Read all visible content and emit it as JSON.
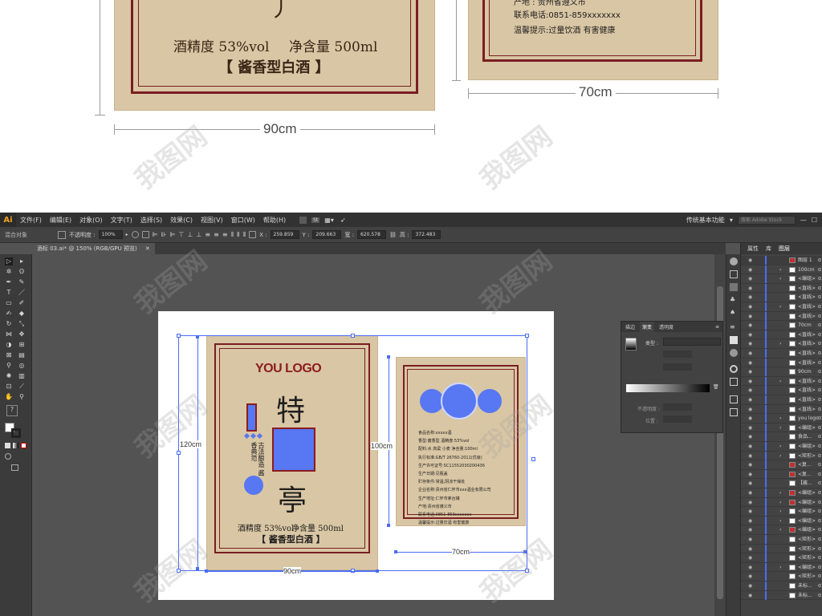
{
  "preview": {
    "big_label": {
      "alcohol": "酒精度 53%vol",
      "volume": "净含量 500ml",
      "type": "【 酱香型白酒 】"
    },
    "small_label": {
      "line_origin": "产地 : 贵州省遵义市",
      "line_phone": "联系电话:0851-859xxxxxxx",
      "line_tip": "温馨提示:过量饮酒 有害健康"
    },
    "dimensions": {
      "big_width": "90cm",
      "small_width": "70cm"
    },
    "watermark": "我图网"
  },
  "app": {
    "logo": "Ai",
    "menu": [
      "文件(F)",
      "编辑(E)",
      "对象(O)",
      "文字(T)",
      "选择(S)",
      "效果(C)",
      "视图(V)",
      "窗口(W)",
      "帮助(H)"
    ],
    "workspace": "传统基本功能",
    "search_placeholder": "搜索 Adobe Stock",
    "mode_icon": "St"
  },
  "control_bar": {
    "selection_label": "混合对象",
    "opacity_label": "不透明度 :",
    "opacity_value": "100%",
    "x_label": "X :",
    "x_value": "259.859",
    "y_label": "Y :",
    "y_value": "209.663",
    "w_label": "宽 :",
    "w_value": "620.578",
    "h_label": "高 :",
    "h_value": "372.483"
  },
  "document": {
    "tab_title": "酒标 03.ai* @ 150% (RGB/GPU 预览)"
  },
  "artwork": {
    "logo": "YOU LOGO",
    "char_top": "特",
    "char_bottom": "亭",
    "side_text": "古法酿造 酱香典范",
    "alcohol": "酒精度  53%vol",
    "volume": "净含量 500ml",
    "type": "【 酱香型白酒 】",
    "dim_height_big": "120cm",
    "dim_height_small": "100cm",
    "dim_width_big": "90cm",
    "dim_width_small": "70cm",
    "back_label_lines": [
      "食品名称:xxxxx酒",
      "香型:酱香型          酒精度:53%vol",
      "配料:水 高粱 小麦     净含量:100ml",
      "执行标准:GB/T 26760-2011(优级)",
      "生产许可证号:SC11552030200436",
      "生产日期:见瓶盖",
      "贮存条件:常温,阴凉干燥处",
      "企业名称:贵州省仁怀市xxx酒业有限公司",
      "生产地址:仁怀市茅台镇",
      "产地:贵州省遵义市",
      "联系电话:0851-859xxxxxxx",
      "温馨提示:过量饮酒 有害健康"
    ]
  },
  "gradient_panel": {
    "tabs": [
      "描边",
      "渐变",
      "透明度"
    ],
    "active_tab": "渐变",
    "type_label": "类型 :",
    "opacity_label": "不透明度 :",
    "position_label": "位置 :"
  },
  "layers_panel": {
    "tabs": [
      "属性",
      "库",
      "图层"
    ],
    "active_tab": "图层",
    "rows": [
      {
        "name": "图层 1",
        "thumb": "#c03030"
      },
      {
        "name": "100cm",
        "thumb": "#ffffff"
      },
      {
        "name": "<编组>",
        "thumb": "#ffffff"
      },
      {
        "name": "<直线>",
        "thumb": "#ffffff"
      },
      {
        "name": "<直线>",
        "thumb": "#ffffff"
      },
      {
        "name": "<直线>",
        "thumb": "#ffffff"
      },
      {
        "name": "<直线>",
        "thumb": "#ffffff"
      },
      {
        "name": "70cm",
        "thumb": "#ffffff"
      },
      {
        "name": "<直线>",
        "thumb": "#ffffff"
      },
      {
        "name": "<直线>",
        "thumb": "#ffffff"
      },
      {
        "name": "<直线>",
        "thumb": "#ffffff"
      },
      {
        "name": "<直线>",
        "thumb": "#ffffff"
      },
      {
        "name": "90cm",
        "thumb": "#ffffff"
      },
      {
        "name": "<直线>",
        "thumb": "#ffffff"
      },
      {
        "name": "<直线>",
        "thumb": "#ffffff"
      },
      {
        "name": "<直线>",
        "thumb": "#ffffff"
      },
      {
        "name": "<直线>",
        "thumb": "#ffffff"
      },
      {
        "name": "you logo",
        "thumb": "#ffffff"
      },
      {
        "name": "<编组>",
        "thumb": "#ffffff"
      },
      {
        "name": "食品...",
        "thumb": "#ffffff"
      },
      {
        "name": "<编组>",
        "thumb": "#ffffff"
      },
      {
        "name": "<矩形>",
        "thumb": "#ffffff"
      },
      {
        "name": "<复...",
        "thumb": "#c03030"
      },
      {
        "name": "<复...",
        "thumb": "#c03030"
      },
      {
        "name": "【酱...",
        "thumb": "#ffffff"
      },
      {
        "name": "<编组>",
        "thumb": "#c03030"
      },
      {
        "name": "<编组>",
        "thumb": "#c03030"
      },
      {
        "name": "<编组>",
        "thumb": "#ffffff"
      },
      {
        "name": "<编组>",
        "thumb": "#ffffff"
      },
      {
        "name": "<编组>",
        "thumb": "#c03030"
      },
      {
        "name": "<矩形>",
        "thumb": "#ffffff"
      },
      {
        "name": "<矩形>",
        "thumb": "#ffffff"
      },
      {
        "name": "<矩形>",
        "thumb": "#ffffff"
      },
      {
        "name": "<编组>",
        "thumb": "#ffffff"
      },
      {
        "name": "<矩形>",
        "thumb": "#ffffff"
      },
      {
        "name": "未标...",
        "thumb": "#ffffff"
      },
      {
        "name": "未标...",
        "thumb": "#ffffff"
      }
    ]
  },
  "colors": {
    "paper": "#d9c6a4",
    "frame": "#7a1e22",
    "selection": "#4a6cf7",
    "logo_red": "#8b1c1c"
  }
}
